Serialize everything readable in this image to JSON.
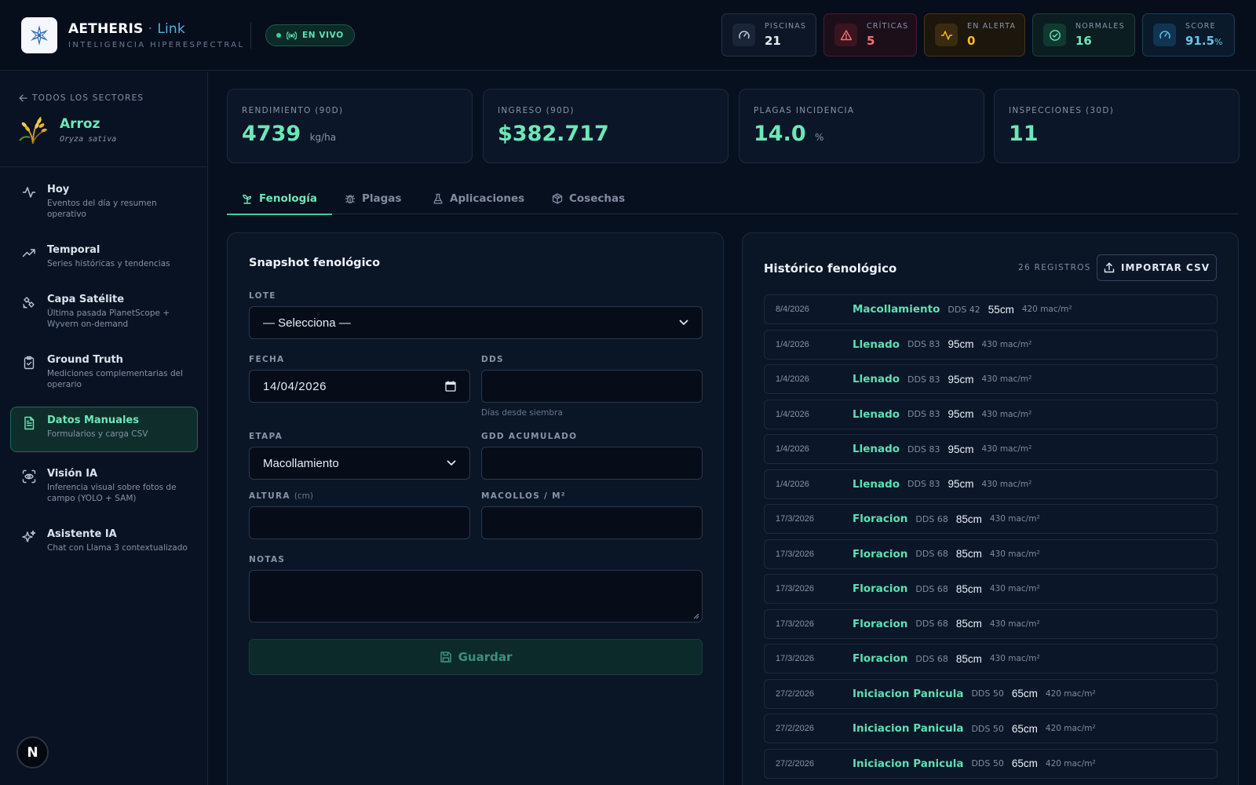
{
  "header": {
    "brand": "AETHERIS",
    "brand_dot": "·",
    "brand_link": "Link",
    "subtitle": "INTELIGENCIA HIPERESPECTRAL",
    "live_label": "EN VIVO",
    "stats": [
      {
        "label": "PISCINAS",
        "value": "21",
        "unit": "",
        "icon": "gauge-icon",
        "color": "#e6edf5"
      },
      {
        "label": "CRÍTICAS",
        "value": "5",
        "unit": "",
        "icon": "alert-triangle-icon",
        "color": "#f87171"
      },
      {
        "label": "EN ALERTA",
        "value": "0",
        "unit": "",
        "icon": "activity-icon",
        "color": "#fbbf24"
      },
      {
        "label": "NORMALES",
        "value": "16",
        "unit": "",
        "icon": "check-circle-icon",
        "color": "#6ee7b7"
      },
      {
        "label": "SCORE",
        "value": "91.5",
        "unit": "%",
        "icon": "gauge-icon",
        "color": "#67c5e8"
      }
    ]
  },
  "sidebar": {
    "back_label": "TODOS LOS SECTORES",
    "crop_name": "Arroz",
    "crop_scientific": "Oryza sativa",
    "items": [
      {
        "title": "Hoy",
        "desc": "Eventos del día y resumen operativo",
        "icon": "activity-icon"
      },
      {
        "title": "Temporal",
        "desc": "Series históricas y tendencias",
        "icon": "trending-up-icon"
      },
      {
        "title": "Capa Satélite",
        "desc": "Última pasada PlanetScope + Wyvern on-demand",
        "icon": "satellite-icon"
      },
      {
        "title": "Ground Truth",
        "desc": "Mediciones complementarias del operario",
        "icon": "clipboard-check-icon"
      },
      {
        "title": "Datos Manuales",
        "desc": "Formularios y carga CSV",
        "icon": "file-text-icon"
      },
      {
        "title": "Visión IA",
        "desc": "Inferencia visual sobre fotos de campo (YOLO + SAM)",
        "icon": "scan-eye-icon"
      },
      {
        "title": "Asistente IA",
        "desc": "Chat con Llama 3 contextualizado",
        "icon": "sparkles-icon"
      }
    ],
    "badge": "N"
  },
  "kpis": [
    {
      "label": "RENDIMIENTO (90D)",
      "value": "4739",
      "unit": "kg/ha"
    },
    {
      "label": "INGRESO (90D)",
      "value": "$382.717",
      "unit": ""
    },
    {
      "label": "PLAGAS INCIDENCIA",
      "value": "14.0",
      "unit": "%"
    },
    {
      "label": "INSPECCIONES (30D)",
      "value": "11",
      "unit": ""
    }
  ],
  "tabs": [
    {
      "label": "Fenología",
      "icon": "sprout-icon"
    },
    {
      "label": "Plagas",
      "icon": "bug-icon"
    },
    {
      "label": "Aplicaciones",
      "icon": "flask-icon"
    },
    {
      "label": "Cosechas",
      "icon": "package-icon"
    }
  ],
  "form": {
    "title": "Snapshot fenológico",
    "lote_label": "LOTE",
    "lote_value": "— Selecciona —",
    "fecha_label": "FECHA",
    "fecha_value": "14/04/2026",
    "dds_label": "DDS",
    "dds_value": "",
    "dds_hint": "Días desde siembra",
    "etapa_label": "ETAPA",
    "etapa_value": "Macollamiento",
    "gdd_label": "GDD ACUMULADO",
    "gdd_value": "",
    "altura_label": "ALTURA",
    "altura_unit": "(cm)",
    "altura_value": "",
    "macollos_label": "MACOLLOS / M²",
    "macollos_value": "",
    "notas_label": "NOTAS",
    "notas_value": "",
    "save_label": "Guardar"
  },
  "history": {
    "title": "Histórico fenológico",
    "count_label": "26 REGISTROS",
    "import_label": "IMPORTAR CSV",
    "rows": [
      {
        "date": "8/4/2026",
        "stage": "Macollamiento",
        "dds": "DDS 42",
        "height": "55cm",
        "density": "420 mac/m²"
      },
      {
        "date": "1/4/2026",
        "stage": "Llenado",
        "dds": "DDS 83",
        "height": "95cm",
        "density": "430 mac/m²"
      },
      {
        "date": "1/4/2026",
        "stage": "Llenado",
        "dds": "DDS 83",
        "height": "95cm",
        "density": "430 mac/m²"
      },
      {
        "date": "1/4/2026",
        "stage": "Llenado",
        "dds": "DDS 83",
        "height": "95cm",
        "density": "430 mac/m²"
      },
      {
        "date": "1/4/2026",
        "stage": "Llenado",
        "dds": "DDS 83",
        "height": "95cm",
        "density": "430 mac/m²"
      },
      {
        "date": "1/4/2026",
        "stage": "Llenado",
        "dds": "DDS 83",
        "height": "95cm",
        "density": "430 mac/m²"
      },
      {
        "date": "17/3/2026",
        "stage": "Floracion",
        "dds": "DDS 68",
        "height": "85cm",
        "density": "430 mac/m²"
      },
      {
        "date": "17/3/2026",
        "stage": "Floracion",
        "dds": "DDS 68",
        "height": "85cm",
        "density": "430 mac/m²"
      },
      {
        "date": "17/3/2026",
        "stage": "Floracion",
        "dds": "DDS 68",
        "height": "85cm",
        "density": "430 mac/m²"
      },
      {
        "date": "17/3/2026",
        "stage": "Floracion",
        "dds": "DDS 68",
        "height": "85cm",
        "density": "430 mac/m²"
      },
      {
        "date": "17/3/2026",
        "stage": "Floracion",
        "dds": "DDS 68",
        "height": "85cm",
        "density": "430 mac/m²"
      },
      {
        "date": "27/2/2026",
        "stage": "Iniciacion Panicula",
        "dds": "DDS 50",
        "height": "65cm",
        "density": "420 mac/m²"
      },
      {
        "date": "27/2/2026",
        "stage": "Iniciacion Panicula",
        "dds": "DDS 50",
        "height": "65cm",
        "density": "420 mac/m²"
      },
      {
        "date": "27/2/2026",
        "stage": "Iniciacion Panicula",
        "dds": "DDS 50",
        "height": "65cm",
        "density": "420 mac/m²"
      }
    ]
  }
}
